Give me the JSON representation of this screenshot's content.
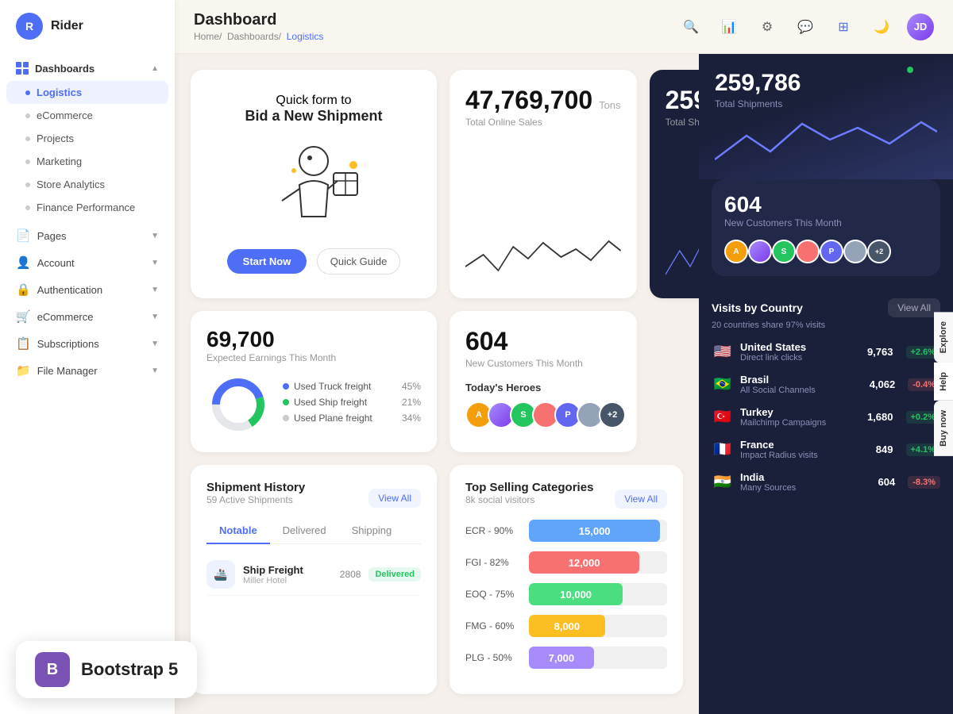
{
  "app": {
    "logo_letter": "R",
    "logo_name": "Rider"
  },
  "sidebar": {
    "sections": [
      {
        "label": "Dashboards",
        "icon": "grid",
        "expanded": true,
        "items": [
          {
            "label": "Logistics",
            "active": true
          },
          {
            "label": "eCommerce",
            "active": false
          },
          {
            "label": "Projects",
            "active": false
          },
          {
            "label": "Marketing",
            "active": false
          },
          {
            "label": "Store Analytics",
            "active": false
          },
          {
            "label": "Finance Performance",
            "active": false
          }
        ]
      },
      {
        "label": "Pages",
        "icon": "file",
        "expanded": false,
        "items": []
      }
    ],
    "bottom_items": [
      {
        "label": "Account",
        "icon": "user"
      },
      {
        "label": "Authentication",
        "icon": "lock"
      },
      {
        "label": "eCommerce",
        "icon": "cart"
      },
      {
        "label": "Subscriptions",
        "icon": "sub"
      },
      {
        "label": "File Manager",
        "icon": "file"
      }
    ]
  },
  "header": {
    "title": "Dashboard",
    "breadcrumb": [
      "Home",
      "Dashboards",
      "Logistics"
    ]
  },
  "shipment_card": {
    "subtitle": "Quick form to",
    "title": "Bid a New Shipment",
    "btn_primary": "Start Now",
    "btn_secondary": "Quick Guide"
  },
  "stat_total_sales": {
    "number": "47,769,700",
    "unit": "Tons",
    "label": "Total Online Sales"
  },
  "stat_total_shipments": {
    "number": "259,786",
    "label": "Total Shipments"
  },
  "stat_earnings": {
    "number": "69,700",
    "label": "Expected Earnings This Month"
  },
  "donut": {
    "items": [
      {
        "label": "Used Truck freight",
        "pct": "45%",
        "color": "#4f6ef7"
      },
      {
        "label": "Used Ship freight",
        "pct": "21%",
        "color": "#22c55e"
      },
      {
        "label": "Used Plane freight",
        "pct": "34%",
        "color": "#e5e7eb"
      }
    ]
  },
  "stat_customers": {
    "number": "604",
    "label": "New Customers This Month"
  },
  "heroes": {
    "label": "Today's Heroes",
    "avatars": [
      {
        "letter": "A",
        "color": "#f59e0b"
      },
      {
        "letter": "",
        "color": "#a78bfa"
      },
      {
        "letter": "S",
        "color": "#22c55e"
      },
      {
        "letter": "",
        "color": "#f87171"
      },
      {
        "letter": "P",
        "color": "#6366f1"
      },
      {
        "letter": "",
        "color": "#94a3b8"
      },
      {
        "letter": "+2",
        "color": "#475569"
      }
    ]
  },
  "shipment_history": {
    "title": "Shipment History",
    "sub": "59 Active Shipments",
    "view_all": "View All",
    "tabs": [
      "Notable",
      "Delivered",
      "Shipping"
    ],
    "active_tab": "Notable",
    "items": [
      {
        "name": "Ship Freight",
        "detail": "Miller Hotel",
        "id": "2808",
        "status": "Delivered",
        "icon": "🚢"
      }
    ]
  },
  "top_selling": {
    "title": "Top Selling Categories",
    "sub": "8k social visitors",
    "view_all": "View All",
    "bars": [
      {
        "label": "ECR - 90%",
        "value": 15000,
        "display": "15,000",
        "color": "#60a5fa",
        "pct": 95
      },
      {
        "label": "FGI - 82%",
        "value": 12000,
        "display": "12,000",
        "color": "#f87171",
        "pct": 80
      },
      {
        "label": "EOQ - 75%",
        "value": 10000,
        "display": "10,000",
        "color": "#4ade80",
        "pct": 68
      },
      {
        "label": "FMG - 60%",
        "value": 8000,
        "display": "8,000",
        "color": "#fbbf24",
        "pct": 55
      },
      {
        "label": "PLG - 50%",
        "value": 7000,
        "display": "7,000",
        "color": "#a78bfa",
        "pct": 47
      }
    ]
  },
  "right_panel": {
    "stat1": {
      "number": "259,786",
      "label": "Total Shipments"
    },
    "stat2": {
      "number": "604",
      "label": "New Customers This Month"
    },
    "side_tabs": [
      "Explore",
      "Help",
      "Buy now"
    ],
    "visits_title": "Visits by Country",
    "visits_sub": "20 countries share 97% visits",
    "view_all": "View All",
    "countries": [
      {
        "flag": "🇺🇸",
        "name": "United States",
        "source": "Direct link clicks",
        "num": "9,763",
        "change": "+2.6%",
        "up": true
      },
      {
        "flag": "🇧🇷",
        "name": "Brasil",
        "source": "All Social Channels",
        "num": "4,062",
        "change": "-0.4%",
        "up": false
      },
      {
        "flag": "🇹🇷",
        "name": "Turkey",
        "source": "Mailchimp Campaigns",
        "num": "1,680",
        "change": "+0.2%",
        "up": true
      },
      {
        "flag": "🇫🇷",
        "name": "France",
        "source": "Impact Radius visits",
        "num": "849",
        "change": "+4.1%",
        "up": true
      },
      {
        "flag": "🇮🇳",
        "name": "India",
        "source": "Many Sources",
        "num": "604",
        "change": "-8.3%",
        "up": false
      }
    ]
  },
  "watermark": {
    "icon": "B",
    "text": "Bootstrap 5"
  }
}
